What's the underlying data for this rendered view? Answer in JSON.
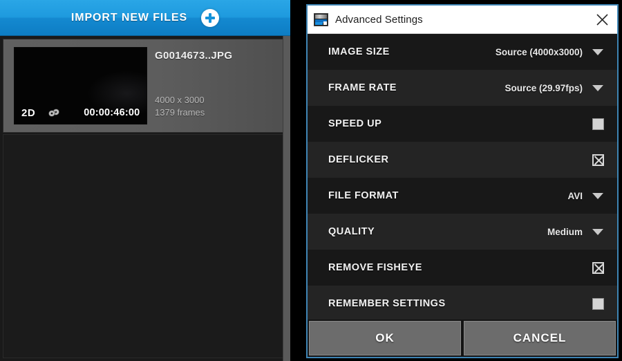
{
  "left_panel": {
    "import_bar": {
      "label": "IMPORT NEW FILES",
      "add_icon": "plus-circle-icon"
    },
    "file_card": {
      "name": "G0014673..JPG",
      "dimensions": "4000 x 3000",
      "frames": "1379 frames",
      "thumbnail": {
        "badge": "2D",
        "media_icon": "film-reel-icon",
        "timecode": "00:00:46:00"
      }
    }
  },
  "dialog": {
    "title": "Advanced Settings",
    "app_icon": "gopro-studio-icon",
    "close_icon": "close-icon",
    "settings": [
      {
        "label": "IMAGE SIZE",
        "type": "dropdown",
        "value": "Source (4000x3000)"
      },
      {
        "label": "FRAME RATE",
        "type": "dropdown",
        "value": "Source (29.97fps)"
      },
      {
        "label": "SPEED UP",
        "type": "checkbox",
        "checked": false
      },
      {
        "label": "DEFLICKER",
        "type": "checkbox",
        "checked": true
      },
      {
        "label": "FILE FORMAT",
        "type": "dropdown",
        "value": "AVI"
      },
      {
        "label": "QUALITY",
        "type": "dropdown",
        "value": "Medium"
      },
      {
        "label": "REMOVE FISHEYE",
        "type": "checkbox",
        "checked": true
      },
      {
        "label": "REMEMBER SETTINGS",
        "type": "checkbox",
        "checked": false
      }
    ],
    "buttons": {
      "ok": "OK",
      "cancel": "CANCEL"
    }
  },
  "colors": {
    "accent_blue": "#1e9ade",
    "dialog_border": "#3f85b5",
    "panel_dark": "#141414",
    "row_dark": "#181818",
    "row_light": "#242424",
    "button_gray": "#6c6c6c"
  }
}
